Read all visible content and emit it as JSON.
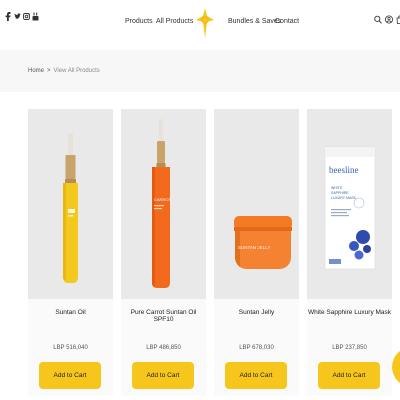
{
  "header": {
    "social_icons": [
      "facebook-icon",
      "twitter-icon",
      "instagram-icon",
      "youtube-icon"
    ],
    "nav": {
      "products": "Products",
      "all_products": "All Products",
      "bundles": "Bundles & Saves",
      "contact": "Contact"
    },
    "right_icons": [
      "search-icon",
      "account-icon",
      "bag-icon"
    ]
  },
  "breadcrumb": {
    "home": "Home",
    "separator": ">",
    "current": "View All Products"
  },
  "products": [
    {
      "name": "Suntan Oil",
      "price": "LBP 516,040",
      "button": "Add to Cart"
    },
    {
      "name": "Pure Carrot Suntan Oil SPF10",
      "price": "LBP 486,850",
      "button": "Add to Cart"
    },
    {
      "name": "Suntan Jelly",
      "price": "LBP 678,030",
      "button": "Add to Cart"
    },
    {
      "name": "White Sapphire Luxury Mask",
      "price": "LBP 237,850",
      "button": "Add to Cart"
    }
  ],
  "product_images": {
    "p2_label": "CARROT",
    "p3_label": "SUNTAN JELLY",
    "p4_brand": "beesline",
    "p4_line1": "WHITE",
    "p4_line2": "SAPPHIRE",
    "p4_line3": "LUXURY MASK"
  },
  "colors": {
    "accent": "#f7c61c",
    "card_bg": "#e9e9e9",
    "band_bg": "#f7f7f7"
  }
}
